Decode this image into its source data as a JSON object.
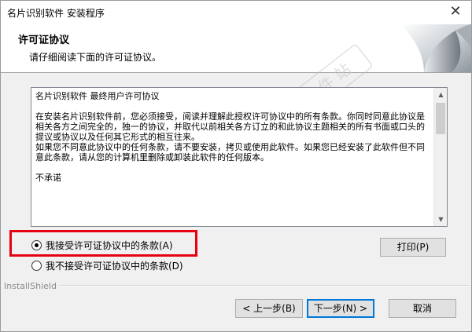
{
  "window": {
    "title": "名片识别软件 安装程序",
    "close_glyph": "✕"
  },
  "header": {
    "title": "许可证协议",
    "subtitle": "请仔细阅读下面的许可证协议。"
  },
  "license": {
    "text": "名片识别软件 最终用户许可协议\n\n在安装名片识别软件前，您必须接受，阅读并理解此授权许可协议中的所有条款。你同时同意此协议是相关各方之间完全的，独一的协议，并取代以前相关各方订立的和此协议主题相关的所有书面或口头的提议或协议以及任何其它形式的相互往来。\n如果您不同意此协议中的任何条款，请不要安装，拷贝或使用此软件。如果您已经安装了此软件但不同意此条款，请从您的计算机里删除或卸装此软件的任何版本。\n\n不承诺"
  },
  "options": {
    "accept_label": "我接受许可证协议中的条款(A)",
    "decline_label": "我不接受许可证协议中的条款(D)",
    "selected": "accept"
  },
  "buttons": {
    "print": "打印(P)",
    "back": "< 上一步(B)",
    "next": "下一步(N) >",
    "cancel": "取消"
  },
  "footer": {
    "brand": "InstallShield"
  },
  "watermark": {
    "text": "3 2 软 件 站"
  },
  "colors": {
    "highlight": "#e60012",
    "default_button_border": "#0078d7"
  }
}
